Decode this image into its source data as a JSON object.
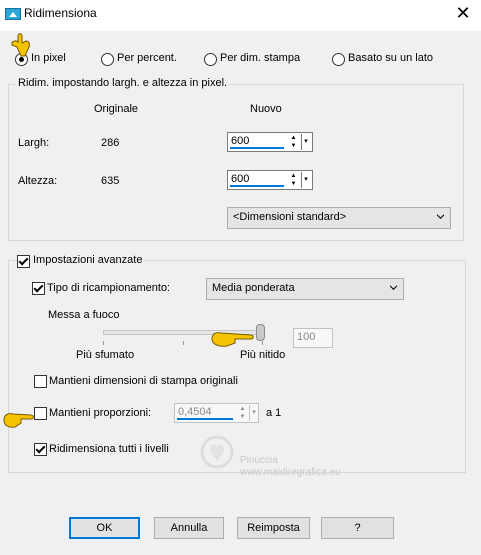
{
  "window": {
    "title": "Ridimensiona",
    "close_glyph": "✕"
  },
  "mode": {
    "options": [
      "In pixel",
      "Per percent.",
      "Per dim. stampa",
      "Basato su un lato"
    ],
    "selected": "In pixel"
  },
  "pixel_group": {
    "title": "Ridim. impostando largh. e altezza in pixel.",
    "col_original": "Originale",
    "col_new": "Nuovo",
    "width_label": "Largh:",
    "width_original": "286",
    "width_new": "600",
    "height_label": "Altezza:",
    "height_original": "635",
    "height_new": "600",
    "standard_sizes": "<Dimensioni standard>"
  },
  "advanced": {
    "label": "Impostazioni avanzate",
    "checked": true,
    "resample_label": "Tipo di ricampionamento:",
    "resample_checked": true,
    "resample_value": "Media ponderata",
    "sharpen_label": "Messa a fuoco",
    "slider_min_label": "Più sfumato",
    "slider_max_label": "Più nitido",
    "slider_value": "100",
    "keep_print_label": "Mantieni dimensioni di stampa originali",
    "keep_print_checked": false,
    "keep_ratio_label": "Mantieni proporzioni:",
    "keep_ratio_checked": false,
    "ratio_value": "0,4504",
    "ratio_suffix": "a 1",
    "resize_layers_label": "Ridimensiona tutti i livelli",
    "resize_layers_checked": true
  },
  "watermark": {
    "line1": "Pinuccia",
    "line2": "www.maidiregrafica.eu"
  },
  "buttons": {
    "ok": "OK",
    "cancel": "Annulla",
    "reset": "Reimposta",
    "help": "?"
  },
  "colors": {
    "accent": "#0078d7",
    "hand": "#f5c400"
  },
  "icons": {
    "pointer": "pointing-hand-icon",
    "app": "resize-app-icon"
  }
}
